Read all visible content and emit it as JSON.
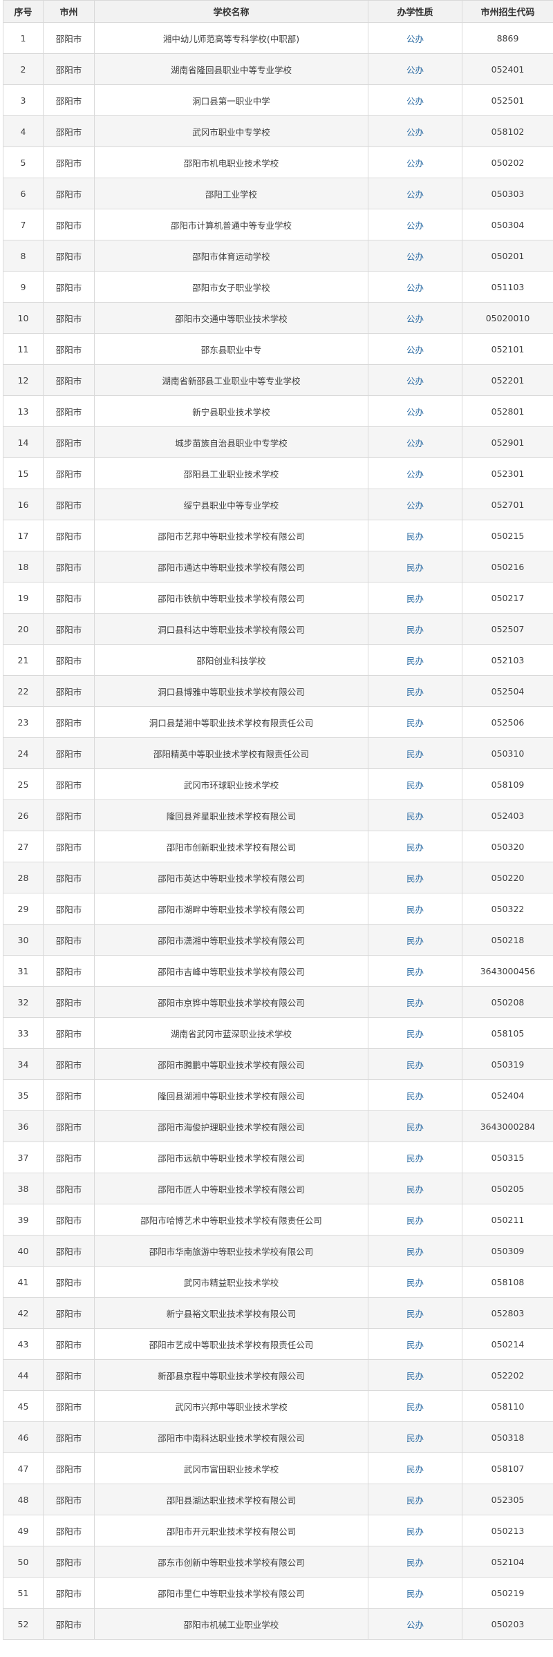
{
  "table": {
    "headers": [
      "序号",
      "市州",
      "学校名称",
      "办学性质",
      "市州招生代码"
    ],
    "rows": [
      {
        "no": "1",
        "city": "邵阳市",
        "name": "湘中幼儿师范高等专科学校(中职部)",
        "nature": "公办",
        "code": "8869"
      },
      {
        "no": "2",
        "city": "邵阳市",
        "name": "湖南省隆回县职业中等专业学校",
        "nature": "公办",
        "code": "052401"
      },
      {
        "no": "3",
        "city": "邵阳市",
        "name": "洞口县第一职业中学",
        "nature": "公办",
        "code": "052501"
      },
      {
        "no": "4",
        "city": "邵阳市",
        "name": "武冈市职业中专学校",
        "nature": "公办",
        "code": "058102"
      },
      {
        "no": "5",
        "city": "邵阳市",
        "name": "邵阳市机电职业技术学校",
        "nature": "公办",
        "code": "050202"
      },
      {
        "no": "6",
        "city": "邵阳市",
        "name": "邵阳工业学校",
        "nature": "公办",
        "code": "050303"
      },
      {
        "no": "7",
        "city": "邵阳市",
        "name": "邵阳市计算机普通中等专业学校",
        "nature": "公办",
        "code": "050304"
      },
      {
        "no": "8",
        "city": "邵阳市",
        "name": "邵阳市体育运动学校",
        "nature": "公办",
        "code": "050201"
      },
      {
        "no": "9",
        "city": "邵阳市",
        "name": "邵阳市女子职业学校",
        "nature": "公办",
        "code": "051103"
      },
      {
        "no": "10",
        "city": "邵阳市",
        "name": "邵阳市交通中等职业技术学校",
        "nature": "公办",
        "code": "05020010"
      },
      {
        "no": "11",
        "city": "邵阳市",
        "name": "邵东县职业中专",
        "nature": "公办",
        "code": "052101"
      },
      {
        "no": "12",
        "city": "邵阳市",
        "name": "湖南省新邵县工业职业中等专业学校",
        "nature": "公办",
        "code": "052201"
      },
      {
        "no": "13",
        "city": "邵阳市",
        "name": "新宁县职业技术学校",
        "nature": "公办",
        "code": "052801"
      },
      {
        "no": "14",
        "city": "邵阳市",
        "name": "城步苗族自治县职业中专学校",
        "nature": "公办",
        "code": "052901"
      },
      {
        "no": "15",
        "city": "邵阳市",
        "name": "邵阳县工业职业技术学校",
        "nature": "公办",
        "code": "052301"
      },
      {
        "no": "16",
        "city": "邵阳市",
        "name": "绥宁县职业中等专业学校",
        "nature": "公办",
        "code": "052701"
      },
      {
        "no": "17",
        "city": "邵阳市",
        "name": "邵阳市艺邦中等职业技术学校有限公司",
        "nature": "民办",
        "code": "050215"
      },
      {
        "no": "18",
        "city": "邵阳市",
        "name": "邵阳市通达中等职业技术学校有限公司",
        "nature": "民办",
        "code": "050216"
      },
      {
        "no": "19",
        "city": "邵阳市",
        "name": "邵阳市铁航中等职业技术学校有限公司",
        "nature": "民办",
        "code": "050217"
      },
      {
        "no": "20",
        "city": "邵阳市",
        "name": "洞口县科达中等职业技术学校有限公司",
        "nature": "民办",
        "code": "052507"
      },
      {
        "no": "21",
        "city": "邵阳市",
        "name": "邵阳创业科技学校",
        "nature": "民办",
        "code": "052103"
      },
      {
        "no": "22",
        "city": "邵阳市",
        "name": "洞口县博雅中等职业技术学校有限公司",
        "nature": "民办",
        "code": "052504"
      },
      {
        "no": "23",
        "city": "邵阳市",
        "name": "洞口县楚湘中等职业技术学校有限责任公司",
        "nature": "民办",
        "code": "052506"
      },
      {
        "no": "24",
        "city": "邵阳市",
        "name": "邵阳精英中等职业技术学校有限责任公司",
        "nature": "民办",
        "code": "050310"
      },
      {
        "no": "25",
        "city": "邵阳市",
        "name": "武冈市环球职业技术学校",
        "nature": "民办",
        "code": "058109"
      },
      {
        "no": "26",
        "city": "邵阳市",
        "name": "隆回县斧星职业技术学校有限公司",
        "nature": "民办",
        "code": "052403"
      },
      {
        "no": "27",
        "city": "邵阳市",
        "name": "邵阳市创新职业技术学校有限公司",
        "nature": "民办",
        "code": "050320"
      },
      {
        "no": "28",
        "city": "邵阳市",
        "name": "邵阳市英达中等职业技术学校有限公司",
        "nature": "民办",
        "code": "050220"
      },
      {
        "no": "29",
        "city": "邵阳市",
        "name": "邵阳市湖畔中等职业技术学校有限公司",
        "nature": "民办",
        "code": "050322"
      },
      {
        "no": "30",
        "city": "邵阳市",
        "name": "邵阳市潇湘中等职业技术学校有限公司",
        "nature": "民办",
        "code": "050218"
      },
      {
        "no": "31",
        "city": "邵阳市",
        "name": "邵阳市吉峰中等职业技术学校有限公司",
        "nature": "民办",
        "code": "3643000456"
      },
      {
        "no": "32",
        "city": "邵阳市",
        "name": "邵阳市京铧中等职业技术学校有限公司",
        "nature": "民办",
        "code": "050208"
      },
      {
        "no": "33",
        "city": "邵阳市",
        "name": "湖南省武冈市蓝深职业技术学校",
        "nature": "民办",
        "code": "058105"
      },
      {
        "no": "34",
        "city": "邵阳市",
        "name": "邵阳市腾鹏中等职业技术学校有限公司",
        "nature": "民办",
        "code": "050319"
      },
      {
        "no": "35",
        "city": "邵阳市",
        "name": "隆回县湖湘中等职业技术学校有限公司",
        "nature": "民办",
        "code": "052404"
      },
      {
        "no": "36",
        "city": "邵阳市",
        "name": "邵阳市海俊护理职业技术学校有限公司",
        "nature": "民办",
        "code": "3643000284"
      },
      {
        "no": "37",
        "city": "邵阳市",
        "name": "邵阳市远航中等职业技术学校有限公司",
        "nature": "民办",
        "code": "050315"
      },
      {
        "no": "38",
        "city": "邵阳市",
        "name": "邵阳市匠人中等职业技术学校有限公司",
        "nature": "民办",
        "code": "050205"
      },
      {
        "no": "39",
        "city": "邵阳市",
        "name": "邵阳市哈博艺术中等职业技术学校有限责任公司",
        "nature": "民办",
        "code": "050211"
      },
      {
        "no": "40",
        "city": "邵阳市",
        "name": "邵阳市华南旅游中等职业技术学校有限公司",
        "nature": "民办",
        "code": "050309"
      },
      {
        "no": "41",
        "city": "邵阳市",
        "name": "武冈市精益职业技术学校",
        "nature": "民办",
        "code": "058108"
      },
      {
        "no": "42",
        "city": "邵阳市",
        "name": "新宁县裕文职业技术学校有限公司",
        "nature": "民办",
        "code": "052803"
      },
      {
        "no": "43",
        "city": "邵阳市",
        "name": "邵阳市艺成中等职业技术学校有限责任公司",
        "nature": "民办",
        "code": "050214"
      },
      {
        "no": "44",
        "city": "邵阳市",
        "name": "新邵县京程中等职业技术学校有限公司",
        "nature": "民办",
        "code": "052202"
      },
      {
        "no": "45",
        "city": "邵阳市",
        "name": "武冈市兴邦中等职业技术学校",
        "nature": "民办",
        "code": "058110"
      },
      {
        "no": "46",
        "city": "邵阳市",
        "name": "邵阳市中南科达职业技术学校有限公司",
        "nature": "民办",
        "code": "050318"
      },
      {
        "no": "47",
        "city": "邵阳市",
        "name": "武冈市富田职业技术学校",
        "nature": "民办",
        "code": "058107"
      },
      {
        "no": "48",
        "city": "邵阳市",
        "name": "邵阳县湖达职业技术学校有限公司",
        "nature": "民办",
        "code": "052305"
      },
      {
        "no": "49",
        "city": "邵阳市",
        "name": "邵阳市开元职业技术学校有限公司",
        "nature": "民办",
        "code": "050213"
      },
      {
        "no": "50",
        "city": "邵阳市",
        "name": "邵东市创新中等职业技术学校有限公司",
        "nature": "民办",
        "code": "052104"
      },
      {
        "no": "51",
        "city": "邵阳市",
        "name": "邵阳市里仁中等职业技术学校有限公司",
        "nature": "民办",
        "code": "050219"
      },
      {
        "no": "52",
        "city": "邵阳市",
        "name": "邵阳市机械工业职业学校",
        "nature": "公办",
        "code": "050203"
      }
    ]
  },
  "colors": {
    "header_bg": "#f2f2f2",
    "stripe_bg": "#f5f5f5",
    "border": "#d9d9d9",
    "nature_text": "#2e6da4",
    "body_text": "#404040"
  }
}
